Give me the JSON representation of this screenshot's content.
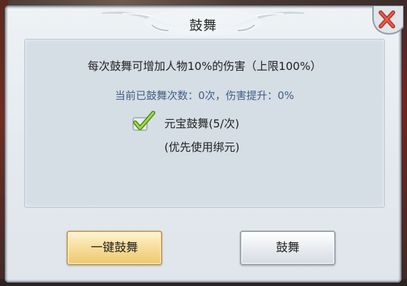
{
  "dialog": {
    "title": "鼓舞",
    "description": "每次鼓舞可增加人物10%的伤害（上限100%）",
    "status": "当前已鼓舞次数：0次，伤害提升：0%",
    "option": {
      "label": "元宝鼓舞(5/次)",
      "note": "(优先使用绑元)",
      "checked": true
    },
    "buttons": {
      "one_click": "一键鼓舞",
      "inspire": "鼓舞"
    },
    "icons": {
      "close": "close-x-icon",
      "checkbox": "checkmark-icon"
    },
    "colors": {
      "status_text": "#3f5f83",
      "close_x": "#c0392b",
      "checkmark": "#7bbf2a",
      "gold_button": "#f7df9e"
    }
  }
}
